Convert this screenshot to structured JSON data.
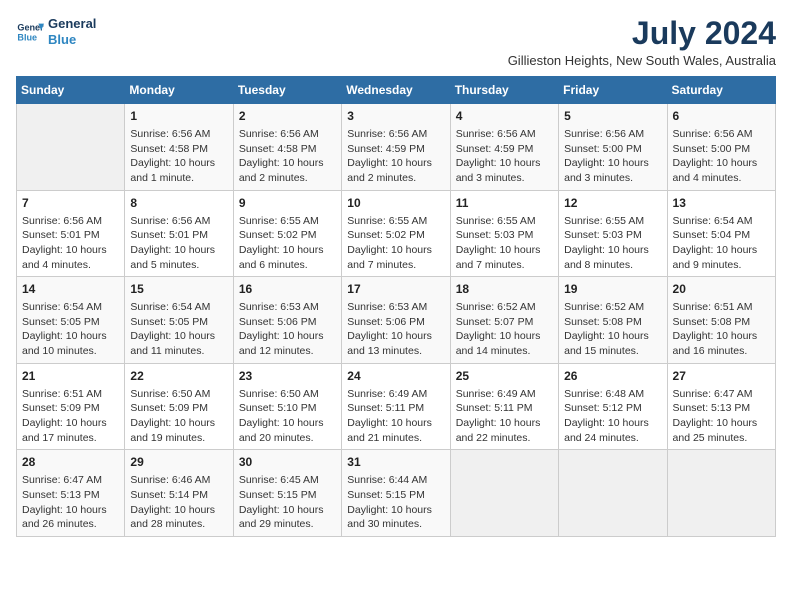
{
  "logo": {
    "line1": "General",
    "line2": "Blue"
  },
  "title": "July 2024",
  "subtitle": "Gillieston Heights, New South Wales, Australia",
  "days_of_week": [
    "Sunday",
    "Monday",
    "Tuesday",
    "Wednesday",
    "Thursday",
    "Friday",
    "Saturday"
  ],
  "weeks": [
    [
      {
        "day": "",
        "info": ""
      },
      {
        "day": "1",
        "info": "Sunrise: 6:56 AM\nSunset: 4:58 PM\nDaylight: 10 hours\nand 1 minute."
      },
      {
        "day": "2",
        "info": "Sunrise: 6:56 AM\nSunset: 4:58 PM\nDaylight: 10 hours\nand 2 minutes."
      },
      {
        "day": "3",
        "info": "Sunrise: 6:56 AM\nSunset: 4:59 PM\nDaylight: 10 hours\nand 2 minutes."
      },
      {
        "day": "4",
        "info": "Sunrise: 6:56 AM\nSunset: 4:59 PM\nDaylight: 10 hours\nand 3 minutes."
      },
      {
        "day": "5",
        "info": "Sunrise: 6:56 AM\nSunset: 5:00 PM\nDaylight: 10 hours\nand 3 minutes."
      },
      {
        "day": "6",
        "info": "Sunrise: 6:56 AM\nSunset: 5:00 PM\nDaylight: 10 hours\nand 4 minutes."
      }
    ],
    [
      {
        "day": "7",
        "info": "Sunrise: 6:56 AM\nSunset: 5:01 PM\nDaylight: 10 hours\nand 4 minutes."
      },
      {
        "day": "8",
        "info": "Sunrise: 6:56 AM\nSunset: 5:01 PM\nDaylight: 10 hours\nand 5 minutes."
      },
      {
        "day": "9",
        "info": "Sunrise: 6:55 AM\nSunset: 5:02 PM\nDaylight: 10 hours\nand 6 minutes."
      },
      {
        "day": "10",
        "info": "Sunrise: 6:55 AM\nSunset: 5:02 PM\nDaylight: 10 hours\nand 7 minutes."
      },
      {
        "day": "11",
        "info": "Sunrise: 6:55 AM\nSunset: 5:03 PM\nDaylight: 10 hours\nand 7 minutes."
      },
      {
        "day": "12",
        "info": "Sunrise: 6:55 AM\nSunset: 5:03 PM\nDaylight: 10 hours\nand 8 minutes."
      },
      {
        "day": "13",
        "info": "Sunrise: 6:54 AM\nSunset: 5:04 PM\nDaylight: 10 hours\nand 9 minutes."
      }
    ],
    [
      {
        "day": "14",
        "info": "Sunrise: 6:54 AM\nSunset: 5:05 PM\nDaylight: 10 hours\nand 10 minutes."
      },
      {
        "day": "15",
        "info": "Sunrise: 6:54 AM\nSunset: 5:05 PM\nDaylight: 10 hours\nand 11 minutes."
      },
      {
        "day": "16",
        "info": "Sunrise: 6:53 AM\nSunset: 5:06 PM\nDaylight: 10 hours\nand 12 minutes."
      },
      {
        "day": "17",
        "info": "Sunrise: 6:53 AM\nSunset: 5:06 PM\nDaylight: 10 hours\nand 13 minutes."
      },
      {
        "day": "18",
        "info": "Sunrise: 6:52 AM\nSunset: 5:07 PM\nDaylight: 10 hours\nand 14 minutes."
      },
      {
        "day": "19",
        "info": "Sunrise: 6:52 AM\nSunset: 5:08 PM\nDaylight: 10 hours\nand 15 minutes."
      },
      {
        "day": "20",
        "info": "Sunrise: 6:51 AM\nSunset: 5:08 PM\nDaylight: 10 hours\nand 16 minutes."
      }
    ],
    [
      {
        "day": "21",
        "info": "Sunrise: 6:51 AM\nSunset: 5:09 PM\nDaylight: 10 hours\nand 17 minutes."
      },
      {
        "day": "22",
        "info": "Sunrise: 6:50 AM\nSunset: 5:09 PM\nDaylight: 10 hours\nand 19 minutes."
      },
      {
        "day": "23",
        "info": "Sunrise: 6:50 AM\nSunset: 5:10 PM\nDaylight: 10 hours\nand 20 minutes."
      },
      {
        "day": "24",
        "info": "Sunrise: 6:49 AM\nSunset: 5:11 PM\nDaylight: 10 hours\nand 21 minutes."
      },
      {
        "day": "25",
        "info": "Sunrise: 6:49 AM\nSunset: 5:11 PM\nDaylight: 10 hours\nand 22 minutes."
      },
      {
        "day": "26",
        "info": "Sunrise: 6:48 AM\nSunset: 5:12 PM\nDaylight: 10 hours\nand 24 minutes."
      },
      {
        "day": "27",
        "info": "Sunrise: 6:47 AM\nSunset: 5:13 PM\nDaylight: 10 hours\nand 25 minutes."
      }
    ],
    [
      {
        "day": "28",
        "info": "Sunrise: 6:47 AM\nSunset: 5:13 PM\nDaylight: 10 hours\nand 26 minutes."
      },
      {
        "day": "29",
        "info": "Sunrise: 6:46 AM\nSunset: 5:14 PM\nDaylight: 10 hours\nand 28 minutes."
      },
      {
        "day": "30",
        "info": "Sunrise: 6:45 AM\nSunset: 5:15 PM\nDaylight: 10 hours\nand 29 minutes."
      },
      {
        "day": "31",
        "info": "Sunrise: 6:44 AM\nSunset: 5:15 PM\nDaylight: 10 hours\nand 30 minutes."
      },
      {
        "day": "",
        "info": ""
      },
      {
        "day": "",
        "info": ""
      },
      {
        "day": "",
        "info": ""
      }
    ]
  ]
}
